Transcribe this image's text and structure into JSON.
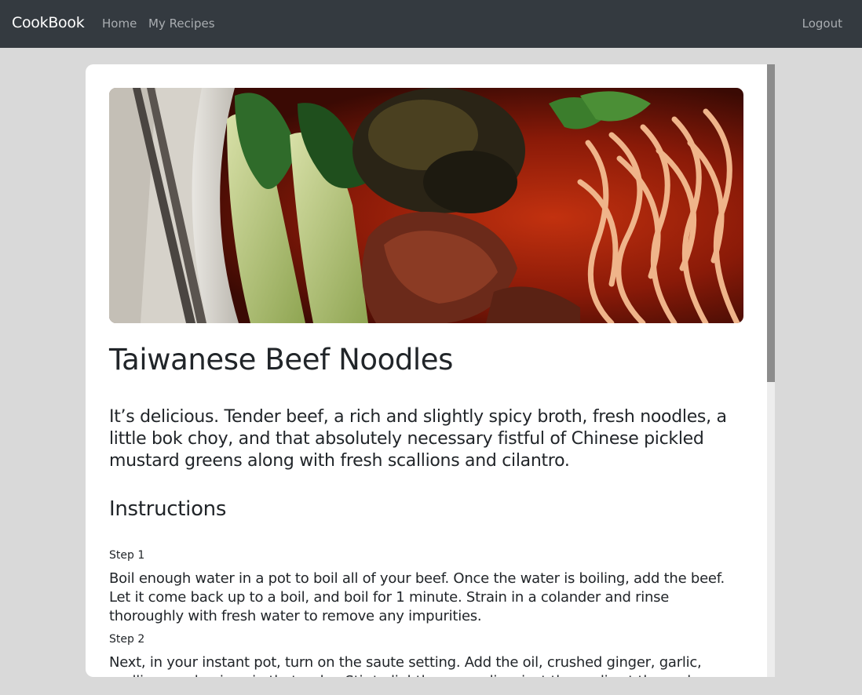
{
  "navbar": {
    "brand": "CookBook",
    "links": [
      "Home",
      "My Recipes"
    ],
    "logout": "Logout",
    "background": "#343a40"
  },
  "recipe": {
    "image_alt_icon": "recipe-photo",
    "title": "Taiwanese Beef Noodles",
    "description": "It’s delicious. Tender beef, a rich and slightly spicy broth, fresh noodles, a little bok choy, and that absolutely necessary fistful of Chinese pickled mustard greens along with fresh scallions and cilantro.",
    "instructions_heading": "Instructions",
    "steps": [
      {
        "label": "Step 1",
        "text": "Boil enough water in a pot to boil all of your beef. Once the water is boiling, add the beef. Let it come back up to a boil, and boil for 1 minute. Strain in a colander and rinse thoroughly with fresh water to remove any impurities."
      },
      {
        "label": "Step 2",
        "text": "Next, in your instant pot, turn on the saute setting. Add the oil, crushed ginger, garlic, scallions and onions in that order. Stir to lightly caramelize, just the garlic at the end."
      }
    ]
  },
  "colors": {
    "page_background": "#d9d9d9",
    "card_background": "#ffffff",
    "text": "#212529",
    "nav_link": "#a9adb1"
  }
}
